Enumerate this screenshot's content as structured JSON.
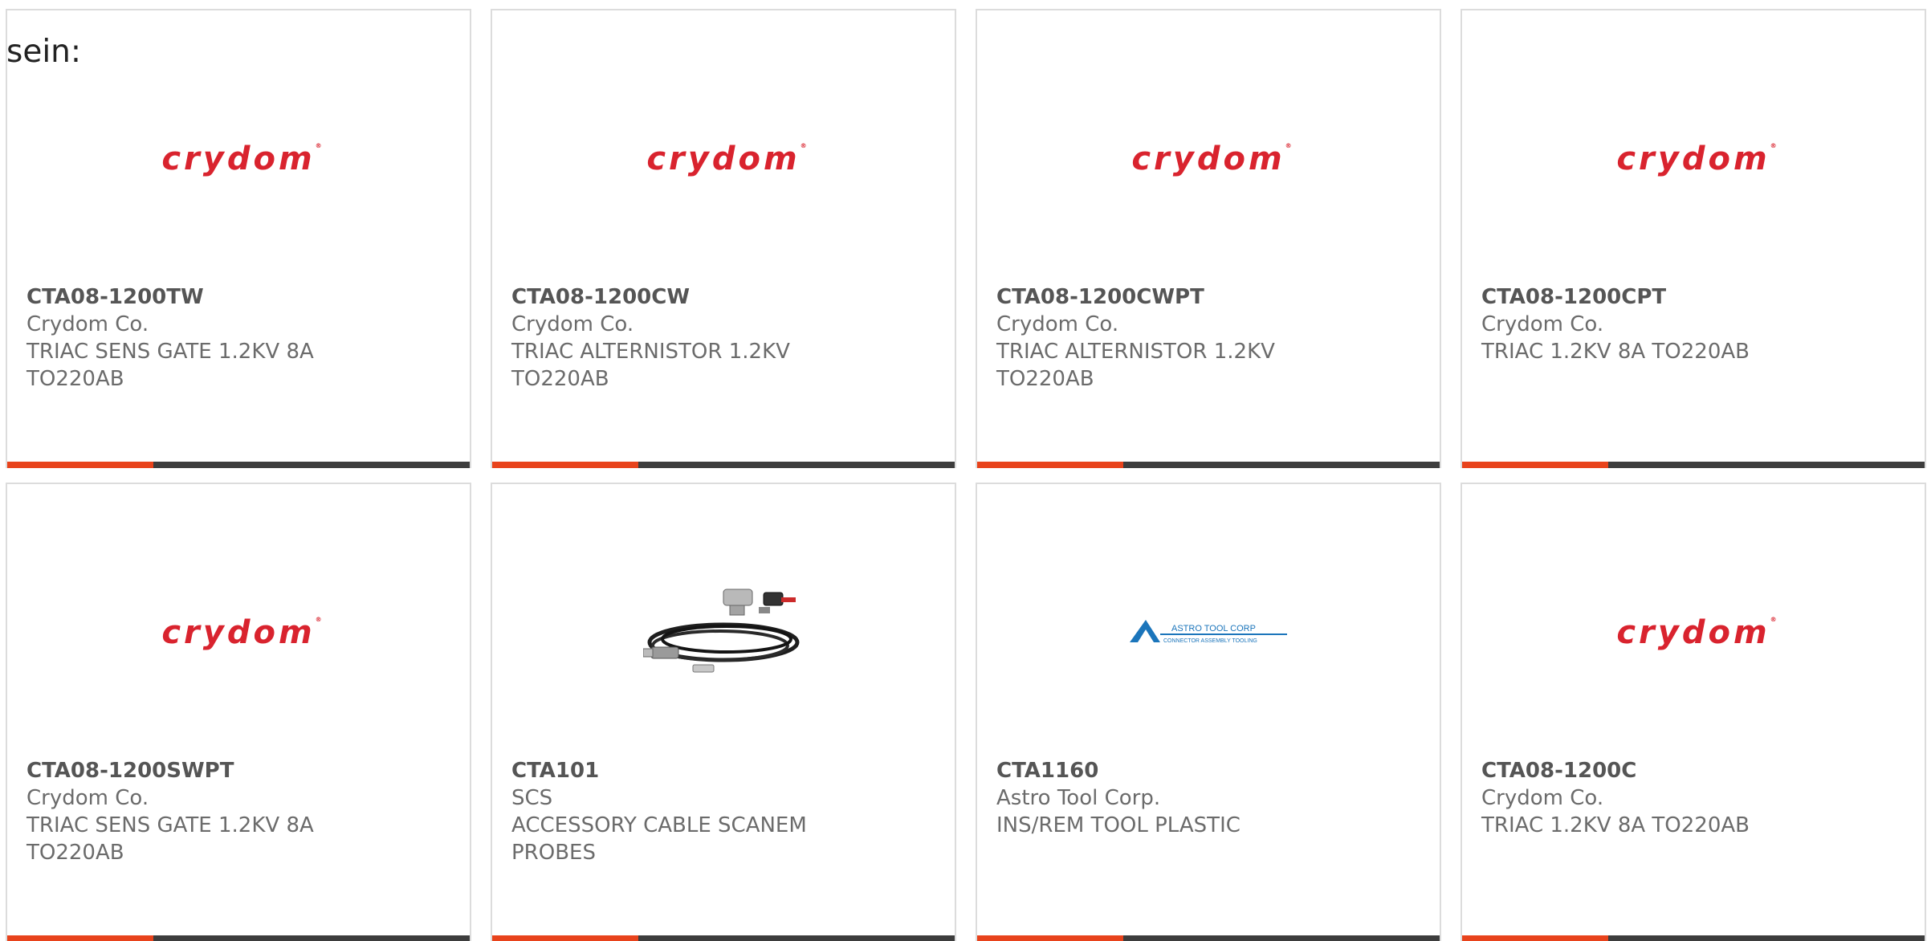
{
  "intro_text": "sein:",
  "colors": {
    "bar_accent": "#e8431c",
    "bar_rest": "#3d3d3d",
    "crydom_red": "#d9232e",
    "astro_blue": "#1b75bb"
  },
  "cards": [
    {
      "logo": "crydom",
      "logo_text": "crydom",
      "part": "CTA08-1200TW",
      "manufacturer": "Crydom Co.",
      "description": "TRIAC SENS GATE 1.2KV 8A TO220AB"
    },
    {
      "logo": "crydom",
      "logo_text": "crydom",
      "part": "CTA08-1200CW",
      "manufacturer": "Crydom Co.",
      "description": "TRIAC ALTERNISTOR 1.2KV TO220AB"
    },
    {
      "logo": "crydom",
      "logo_text": "crydom",
      "part": "CTA08-1200CWPT",
      "manufacturer": "Crydom Co.",
      "description": "TRIAC ALTERNISTOR 1.2KV TO220AB"
    },
    {
      "logo": "crydom",
      "logo_text": "crydom",
      "part": "CTA08-1200CPT",
      "manufacturer": "Crydom Co.",
      "description": "TRIAC 1.2KV 8A TO220AB"
    },
    {
      "logo": "crydom",
      "logo_text": "crydom",
      "part": "CTA08-1200SWPT",
      "manufacturer": "Crydom Co.",
      "description": "TRIAC SENS GATE 1.2KV 8A TO220AB"
    },
    {
      "logo": "cable-photo",
      "part": "CTA101",
      "manufacturer": "SCS",
      "description": "ACCESSORY CABLE SCANEM PROBES"
    },
    {
      "logo": "astro",
      "logo_text": "ASTRO TOOL CORP",
      "logo_subtext": "CONNECTOR ASSEMBLY TOOLING",
      "part": "CTA1160",
      "manufacturer": "Astro Tool Corp.",
      "description": "INS/REM TOOL PLASTIC"
    },
    {
      "logo": "crydom",
      "logo_text": "crydom",
      "part": "CTA08-1200C",
      "manufacturer": "Crydom Co.",
      "description": "TRIAC 1.2KV 8A TO220AB"
    }
  ]
}
